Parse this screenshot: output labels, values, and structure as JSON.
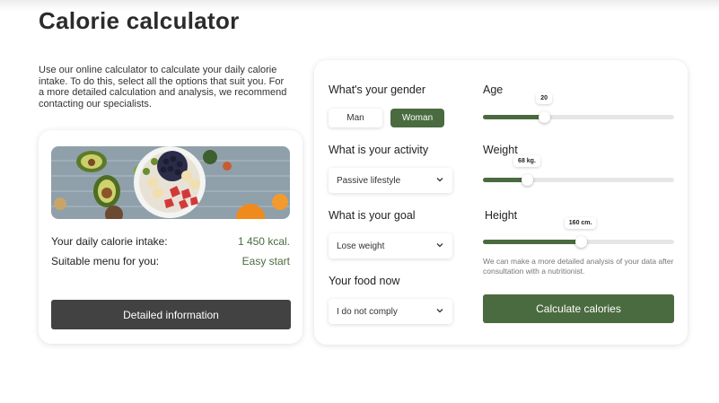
{
  "page": {
    "title": "Calorie calculator",
    "intro": "Use our online calculator to calculate your daily calorie intake. To do this, select all the options that suit you. For a more detailed calculation and analysis, we recommend contacting our specialists."
  },
  "result": {
    "intake_label": "Your daily calorie intake:",
    "intake_value": "1 450 kcal.",
    "menu_label": "Suitable menu for you:",
    "menu_value": "Easy start",
    "detail_button": "Detailed information"
  },
  "form": {
    "gender": {
      "label": "What's your gender",
      "options": [
        "Man",
        "Woman"
      ],
      "selected": "Woman"
    },
    "activity": {
      "label": "What is your activity",
      "value": "Passive lifestyle"
    },
    "goal": {
      "label": "What is your goal",
      "value": "Lose weight"
    },
    "food": {
      "label": "Your food now",
      "value": "I do not comply"
    },
    "age": {
      "label": "Age",
      "value": "20",
      "fraction": 0.32
    },
    "weight": {
      "label": "Weight",
      "value": "68 kg.",
      "fraction": 0.23
    },
    "height": {
      "label": "Height",
      "value": "160 cm.",
      "fraction": 0.51
    },
    "note": "We can make a more detailed analysis of your data after consultation with a nutritionist.",
    "calculate_button": "Calculate calories"
  },
  "colors": {
    "accent": "#4a6b3f",
    "dark_button": "#424242",
    "track": "#e6e6e6"
  },
  "icons": {
    "select_arrow": "chevron-down-icon"
  }
}
